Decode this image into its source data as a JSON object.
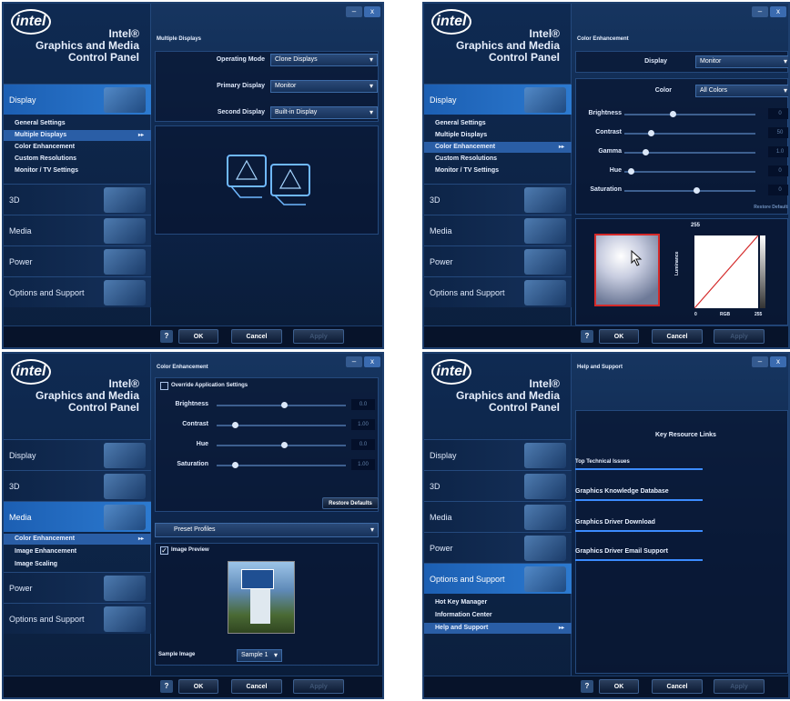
{
  "brand": {
    "logo": "intel",
    "line1": "Intel®",
    "line2": "Graphics and Media",
    "line3": "Control Panel"
  },
  "controls": {
    "minimize": "–",
    "close": "x"
  },
  "footer": {
    "help": "?",
    "ok": "OK",
    "cancel": "Cancel",
    "apply": "Apply"
  },
  "nav": {
    "display": "Display",
    "three_d": "3D",
    "media": "Media",
    "power": "Power",
    "options": "Options and Support"
  },
  "w1": {
    "section": "Multiple Displays",
    "sub": [
      "General Settings",
      "Multiple Displays",
      "Color Enhancement",
      "Custom Resolutions",
      "Monitor / TV Settings"
    ],
    "rows": [
      {
        "label": "Operating Mode",
        "value": "Clone Displays"
      },
      {
        "label": "Primary Display",
        "value": "Monitor"
      },
      {
        "label": "Second Display",
        "value": "Built-in Display"
      }
    ]
  },
  "w2": {
    "section": "Color Enhancement",
    "display_label": "Display",
    "display_value": "Monitor",
    "color_label": "Color",
    "color_value": "All Colors",
    "sliders": [
      {
        "label": "Brightness",
        "value": "0",
        "pos": 0.35
      },
      {
        "label": "Contrast",
        "value": "50",
        "pos": 0.18
      },
      {
        "label": "Gamma",
        "value": "1.0",
        "pos": 0.14
      },
      {
        "label": "Hue",
        "value": "0",
        "pos": 0.03
      },
      {
        "label": "Saturation",
        "value": "0",
        "pos": 0.53
      }
    ],
    "restore": "Restore Defaults",
    "graph": {
      "top": "255",
      "y": "Luminance",
      "x0": "0",
      "x": "RGB",
      "x1": "255"
    }
  },
  "w3": {
    "section": "Color Enhancement",
    "override": "Override Application Settings",
    "sliders": [
      {
        "label": "Brightness",
        "value": "0.0",
        "pos": 0.5
      },
      {
        "label": "Contrast",
        "value": "1.00",
        "pos": 0.12
      },
      {
        "label": "Hue",
        "value": "0.0",
        "pos": 0.5
      },
      {
        "label": "Saturation",
        "value": "1.00",
        "pos": 0.12
      }
    ],
    "restore": "Restore Defaults",
    "preset": "Preset Profiles",
    "preview": "Image Preview",
    "sample_label": "Sample Image",
    "sample_value": "Sample 1",
    "sub": [
      "Color Enhancement",
      "Image Enhancement",
      "Image Scaling"
    ]
  },
  "w4": {
    "section": "Help and Support",
    "heading": "Key Resource Links",
    "links": [
      {
        "title": "Top Technical Issues"
      },
      {
        "title": "Graphics Knowledge Database"
      },
      {
        "title": "Graphics Driver Download"
      },
      {
        "title": "Graphics Driver Email Support"
      }
    ],
    "sub": [
      "Hot Key Manager",
      "Information Center",
      "Help and Support"
    ]
  }
}
